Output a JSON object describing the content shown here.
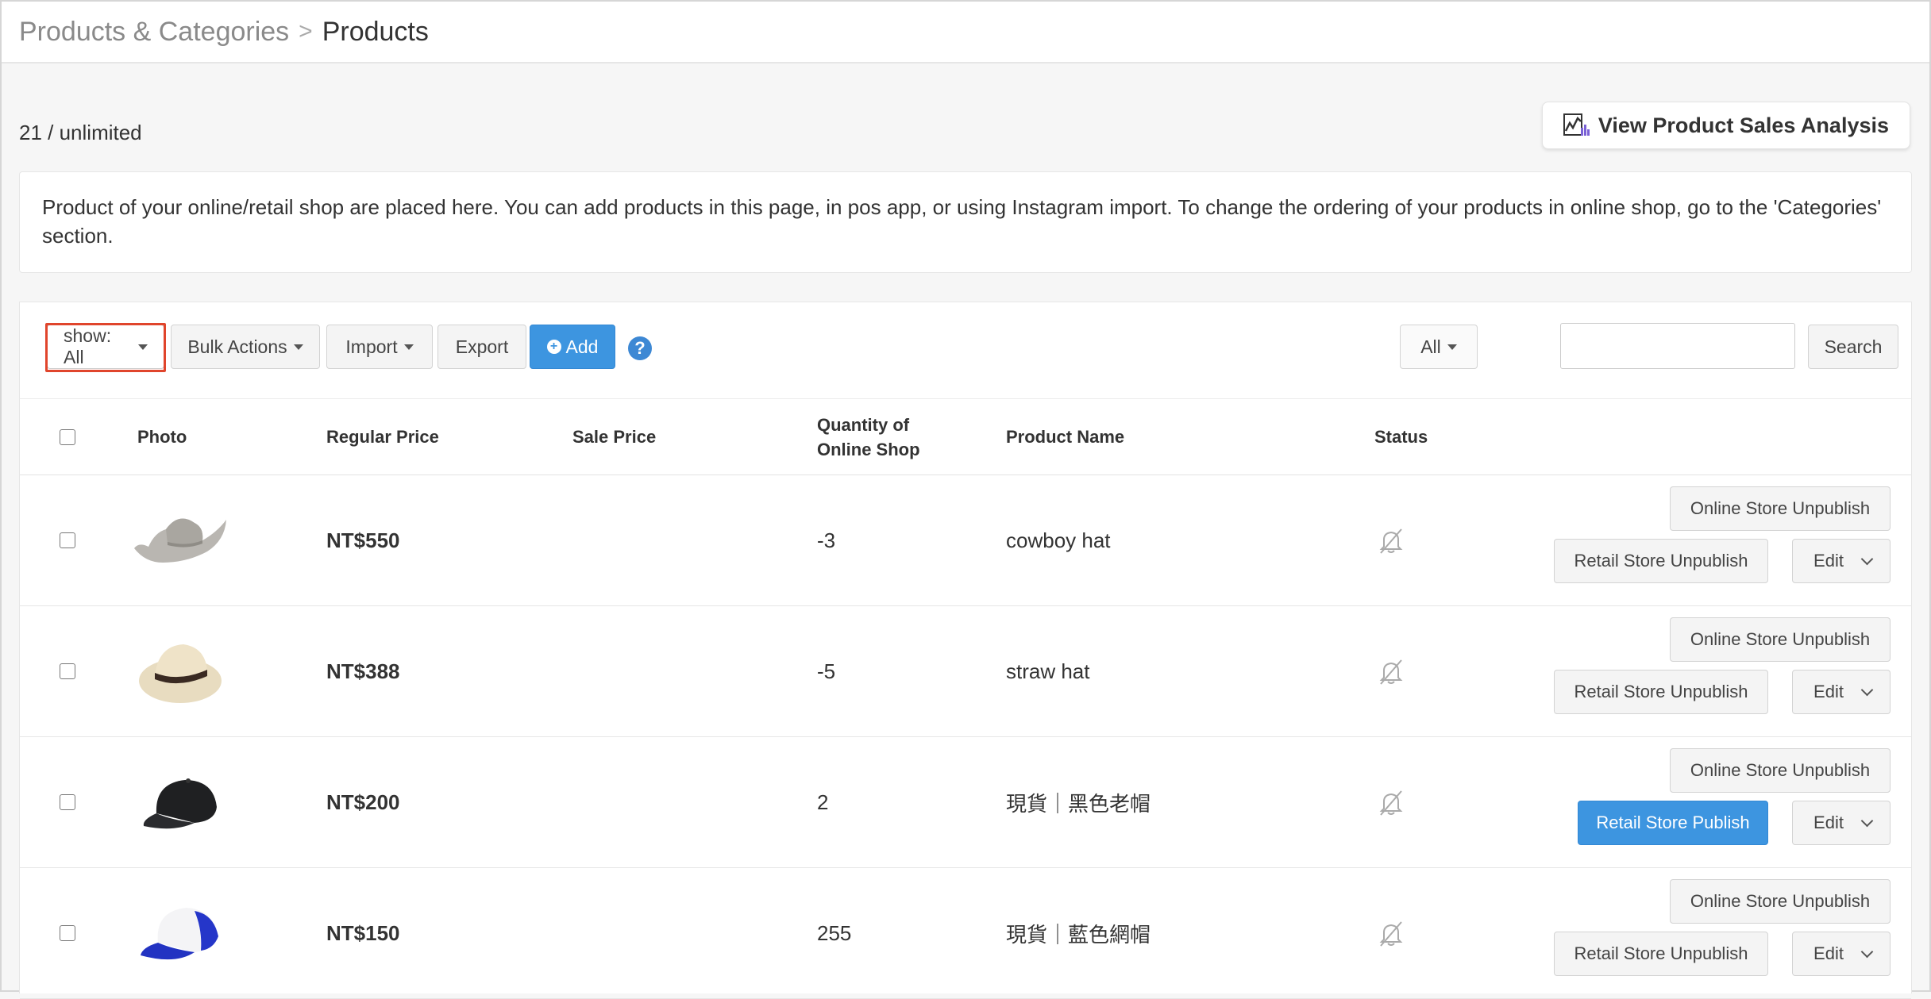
{
  "breadcrumb": {
    "parent": "Products & Categories",
    "separator": ">",
    "current": "Products"
  },
  "product_count": "21 / unlimited",
  "analysis_button": "View Product Sales Analysis",
  "notice": "Product of your online/retail shop are placed here. You can add products in this page, in pos app, or using Instagram import. To change the ordering of your products in online shop, go to the 'Categories' section.",
  "toolbar": {
    "show_label": "show: All",
    "bulk_label": "Bulk Actions",
    "import_label": "Import",
    "export_label": "Export",
    "add_label": "Add",
    "filter_label": "All",
    "search_value": "",
    "search_label": "Search"
  },
  "table": {
    "headers": {
      "photo": "Photo",
      "regular_price": "Regular Price",
      "sale_price": "Sale Price",
      "quantity_line1": "Quantity of",
      "quantity_line2": "Online Shop",
      "product_name": "Product Name",
      "status": "Status"
    },
    "rows": [
      {
        "photo": "cowboy-hat",
        "regular_price": "NT$550",
        "sale_price": "",
        "quantity": "-3",
        "name": "cowboy hat",
        "online_action": "Online Store Unpublish",
        "retail_action": "Retail Store Unpublish",
        "edit": "Edit"
      },
      {
        "photo": "straw-hat",
        "regular_price": "NT$388",
        "sale_price": "",
        "quantity": "-5",
        "name": "straw hat",
        "online_action": "Online Store Unpublish",
        "retail_action": "Retail Store Unpublish",
        "edit": "Edit"
      },
      {
        "photo": "black-cap",
        "regular_price": "NT$200",
        "sale_price": "",
        "quantity": "2",
        "name": "現貨｜黑色老帽",
        "online_action": "Online Store Unpublish",
        "retail_action": "Retail Store Publish",
        "edit": "Edit"
      },
      {
        "photo": "blue-mesh-cap",
        "regular_price": "NT$150",
        "sale_price": "",
        "quantity": "255",
        "name": "現貨｜藍色網帽",
        "online_action": "Online Store Unpublish",
        "retail_action": "Retail Store Unpublish",
        "edit": "Edit"
      }
    ]
  },
  "colors": {
    "primary": "#3d95e0",
    "highlight": "#e0452c"
  },
  "icons": {
    "analysis": "chart-icon",
    "status": "bell-off-icon",
    "help": "question-icon"
  }
}
